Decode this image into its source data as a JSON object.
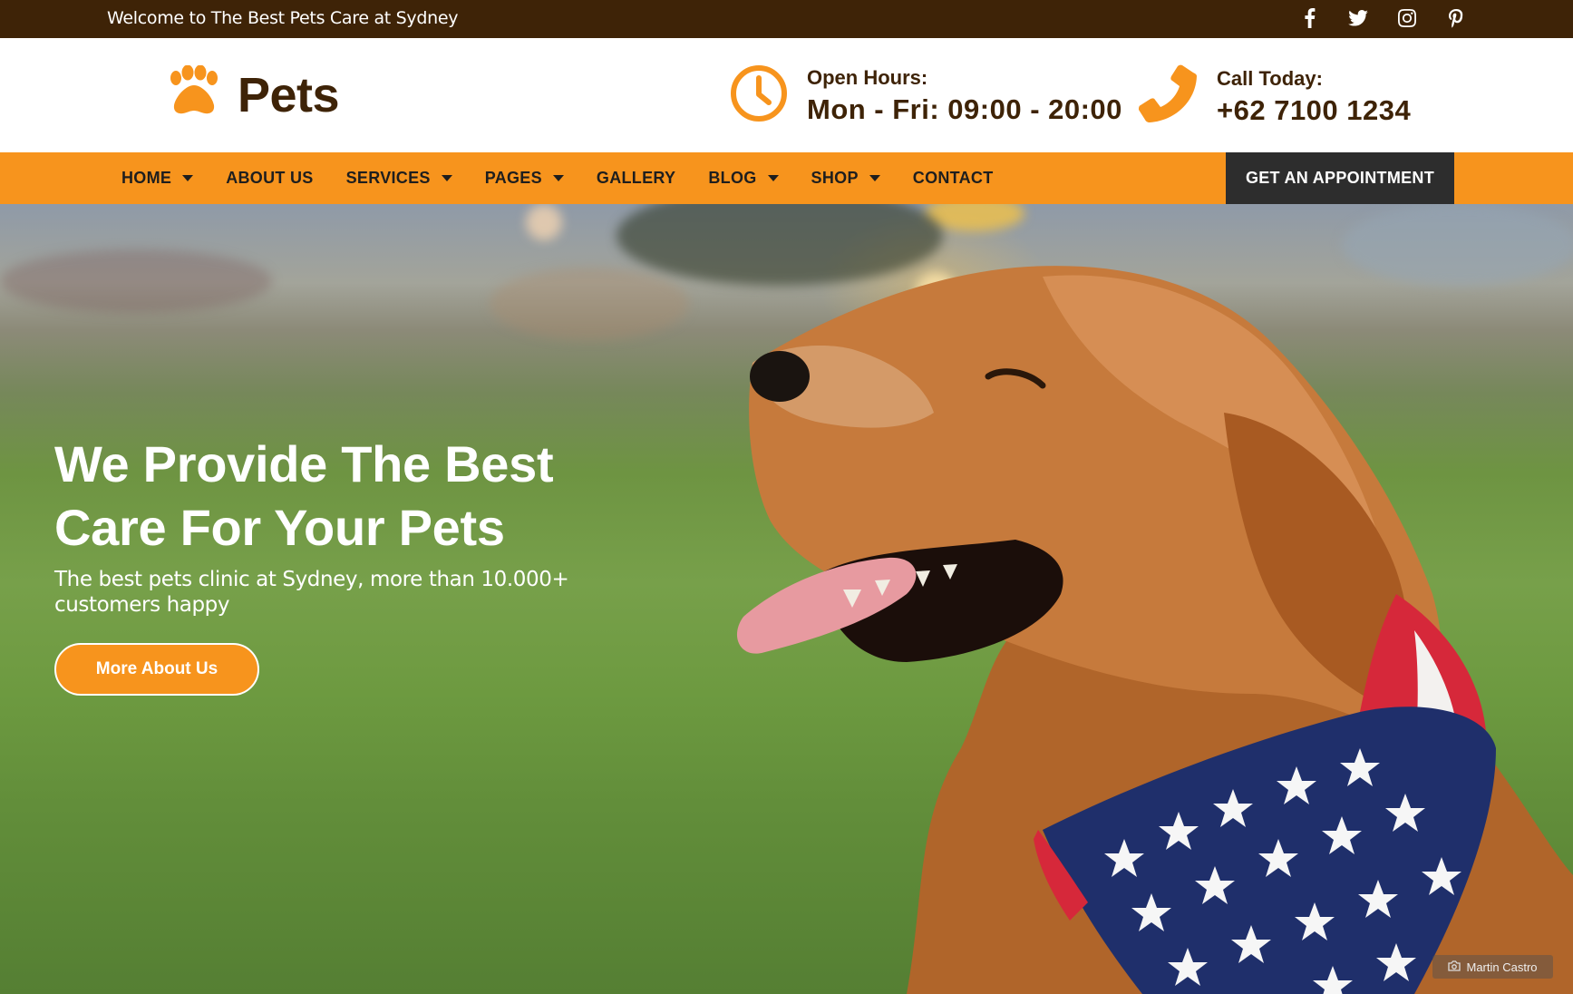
{
  "topbar": {
    "welcome": "Welcome to The Best Pets Care at Sydney",
    "socials": [
      "facebook-icon",
      "twitter-icon",
      "instagram-icon",
      "pinterest-icon"
    ]
  },
  "header": {
    "brand": "Pets",
    "hours_label": "Open Hours:",
    "hours_value": "Mon - Fri: 09:00 - 20:00",
    "call_label": "Call Today:",
    "call_value": "+62 7100 1234"
  },
  "nav": {
    "items": [
      {
        "label": "HOME",
        "dropdown": true
      },
      {
        "label": "ABOUT US",
        "dropdown": false
      },
      {
        "label": "SERVICES",
        "dropdown": true
      },
      {
        "label": "PAGES",
        "dropdown": true
      },
      {
        "label": "GALLERY",
        "dropdown": false
      },
      {
        "label": "BLOG",
        "dropdown": true
      },
      {
        "label": "SHOP",
        "dropdown": true
      },
      {
        "label": "CONTACT",
        "dropdown": false
      }
    ],
    "cta": "GET AN APPOINTMENT"
  },
  "hero": {
    "title": "We Provide The Best Care For Your Pets",
    "subtitle": "The best pets clinic at Sydney, more than 10.000+ customers happy",
    "button": "More About Us",
    "photo_credit": "Martin Castro"
  },
  "colors": {
    "accent": "#f7941d",
    "dark_brown": "#3e2307",
    "dark_button": "#2d2d2d"
  }
}
